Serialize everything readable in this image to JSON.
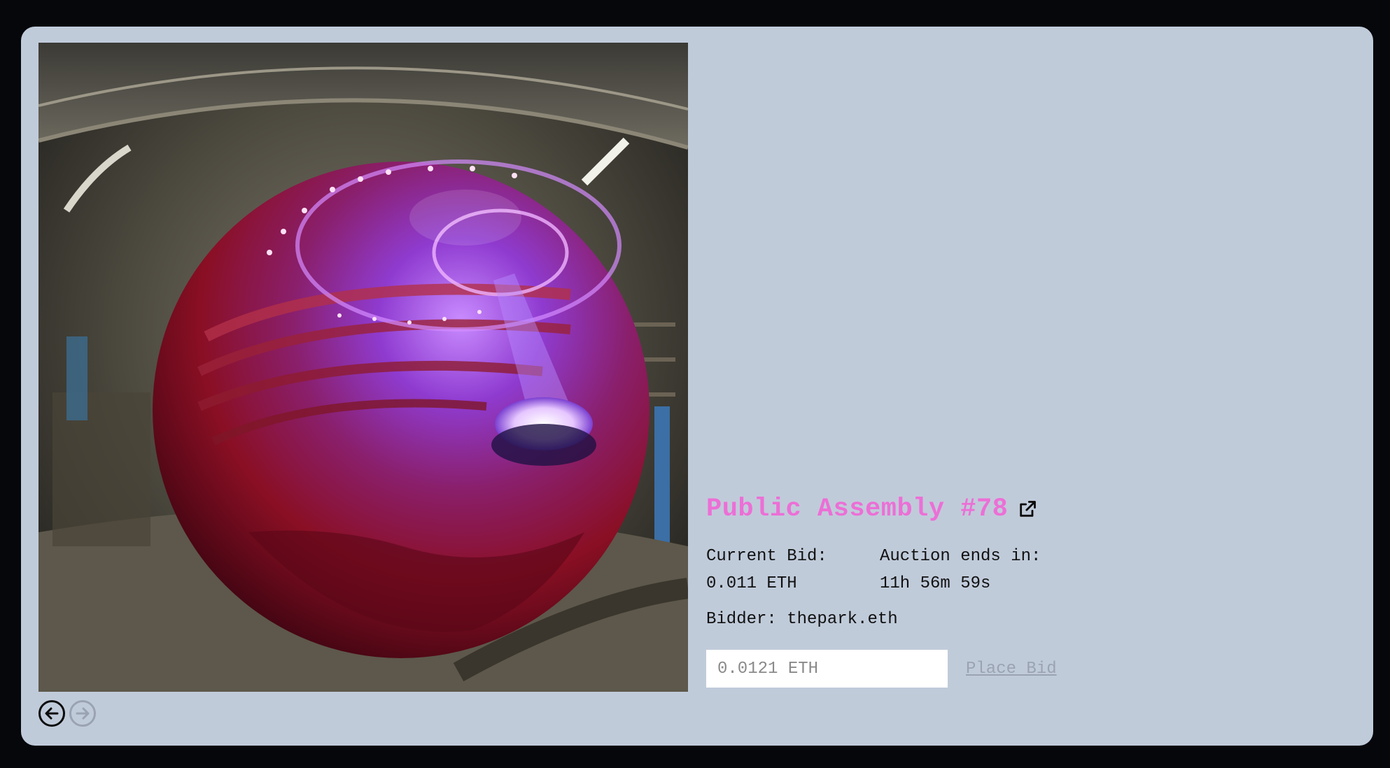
{
  "auction": {
    "title": "Public Assembly #78",
    "current_bid_label": "Current Bid:",
    "current_bid_value": "0.011 ETH",
    "ends_label": "Auction ends in:",
    "ends_value": "11h 56m 59s",
    "bidder_text": "Bidder: thepark.eth",
    "bid_placeholder": "0.0121 ETH",
    "place_bid_label": "Place Bid"
  },
  "icons": {
    "external_link": "external-link-icon",
    "prev": "arrow-left-icon",
    "next": "arrow-right-icon"
  },
  "colors": {
    "card_background": "#c0cbda",
    "page_background": "#05070b",
    "title_accent": "#ec6fd6",
    "disabled": "#9aa3b1"
  }
}
